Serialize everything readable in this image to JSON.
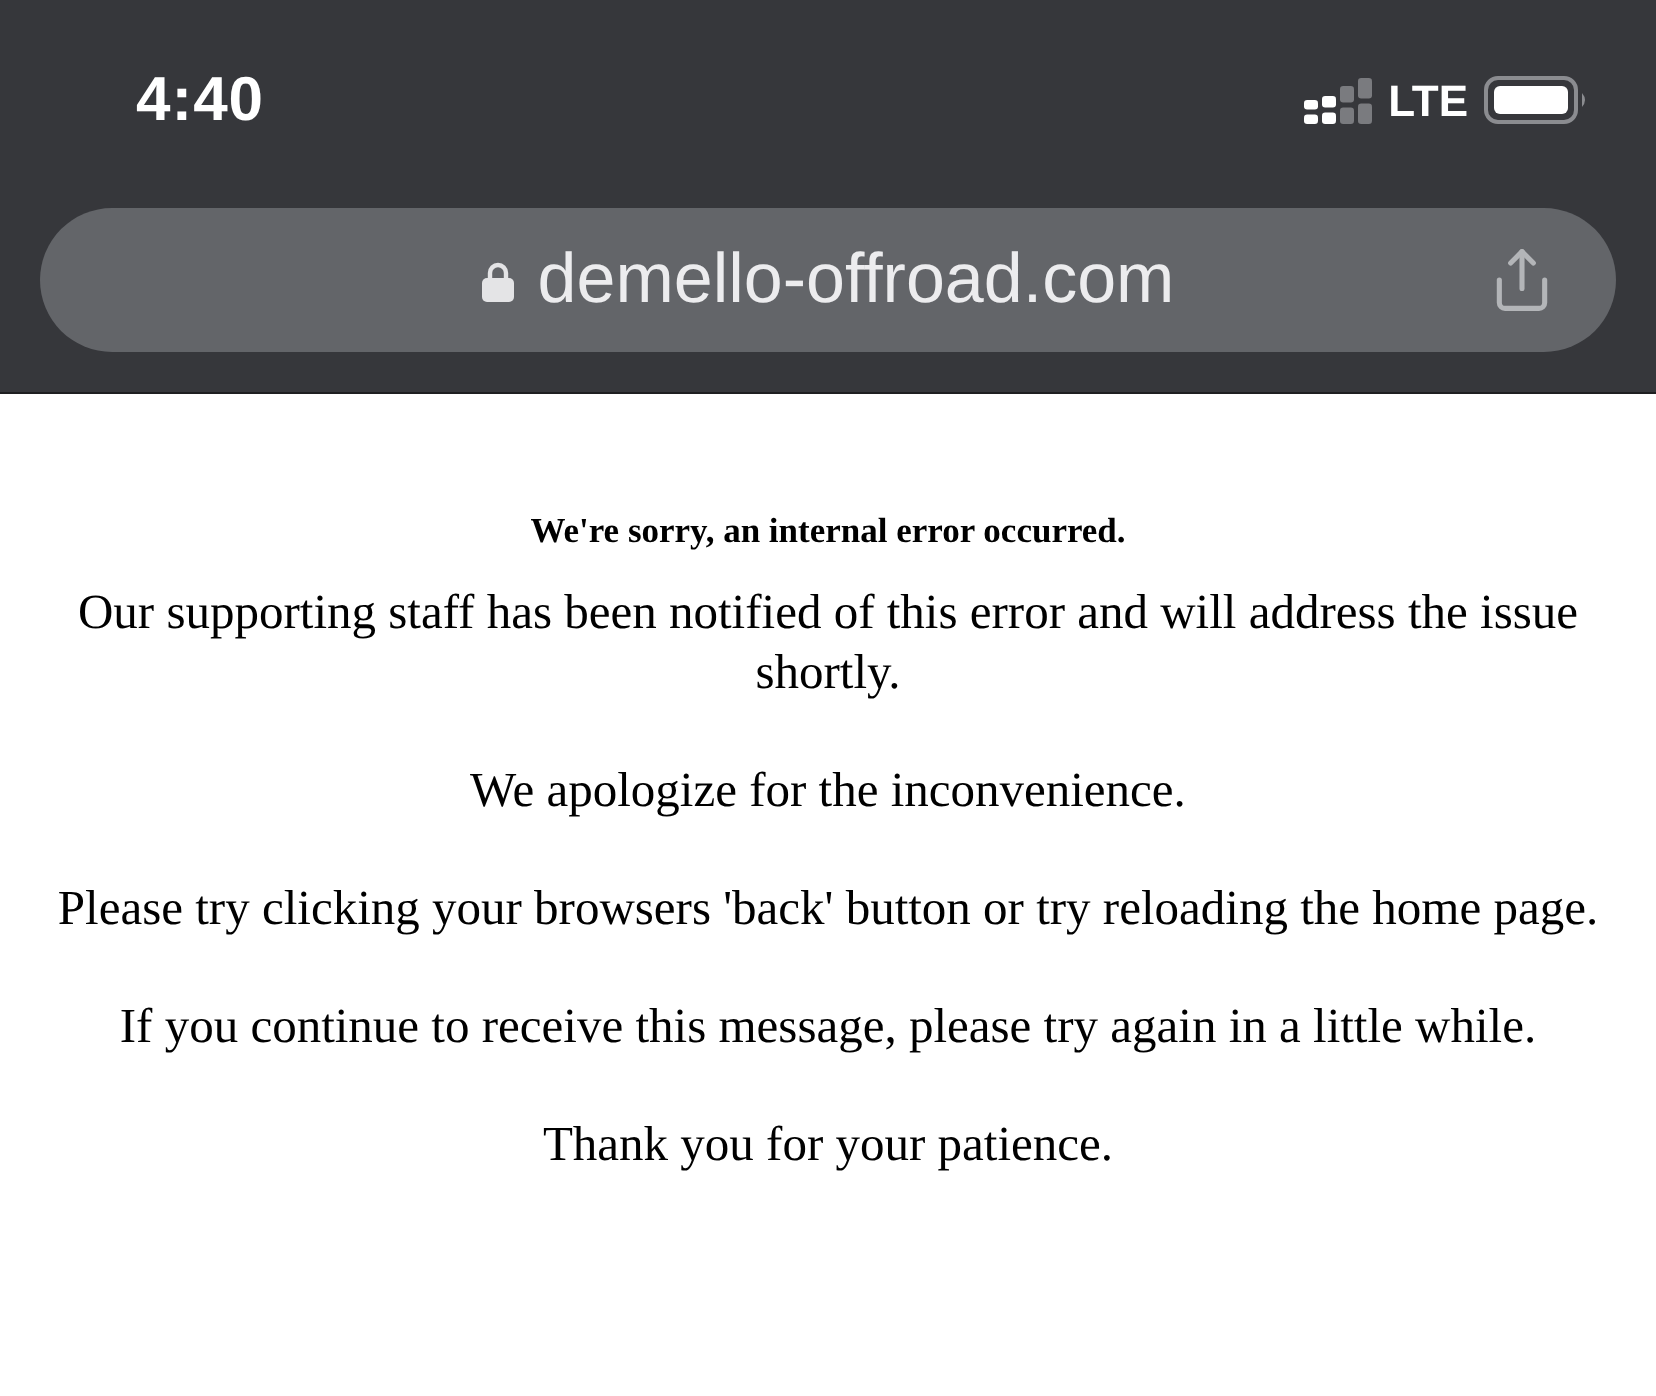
{
  "status_bar": {
    "time": "4:40",
    "network": "LTE"
  },
  "address_bar": {
    "url": "demello-offroad.com"
  },
  "page": {
    "heading": "We're sorry, an internal error occurred.",
    "paragraphs": [
      "Our supporting staff has been notified of this error and will address the issue shortly.",
      "We apologize for the inconvenience.",
      "Please try clicking your browsers 'back' button or try reloading the home page.",
      "If you continue to receive this message, please try again in a little while.",
      "Thank you for your patience."
    ]
  }
}
